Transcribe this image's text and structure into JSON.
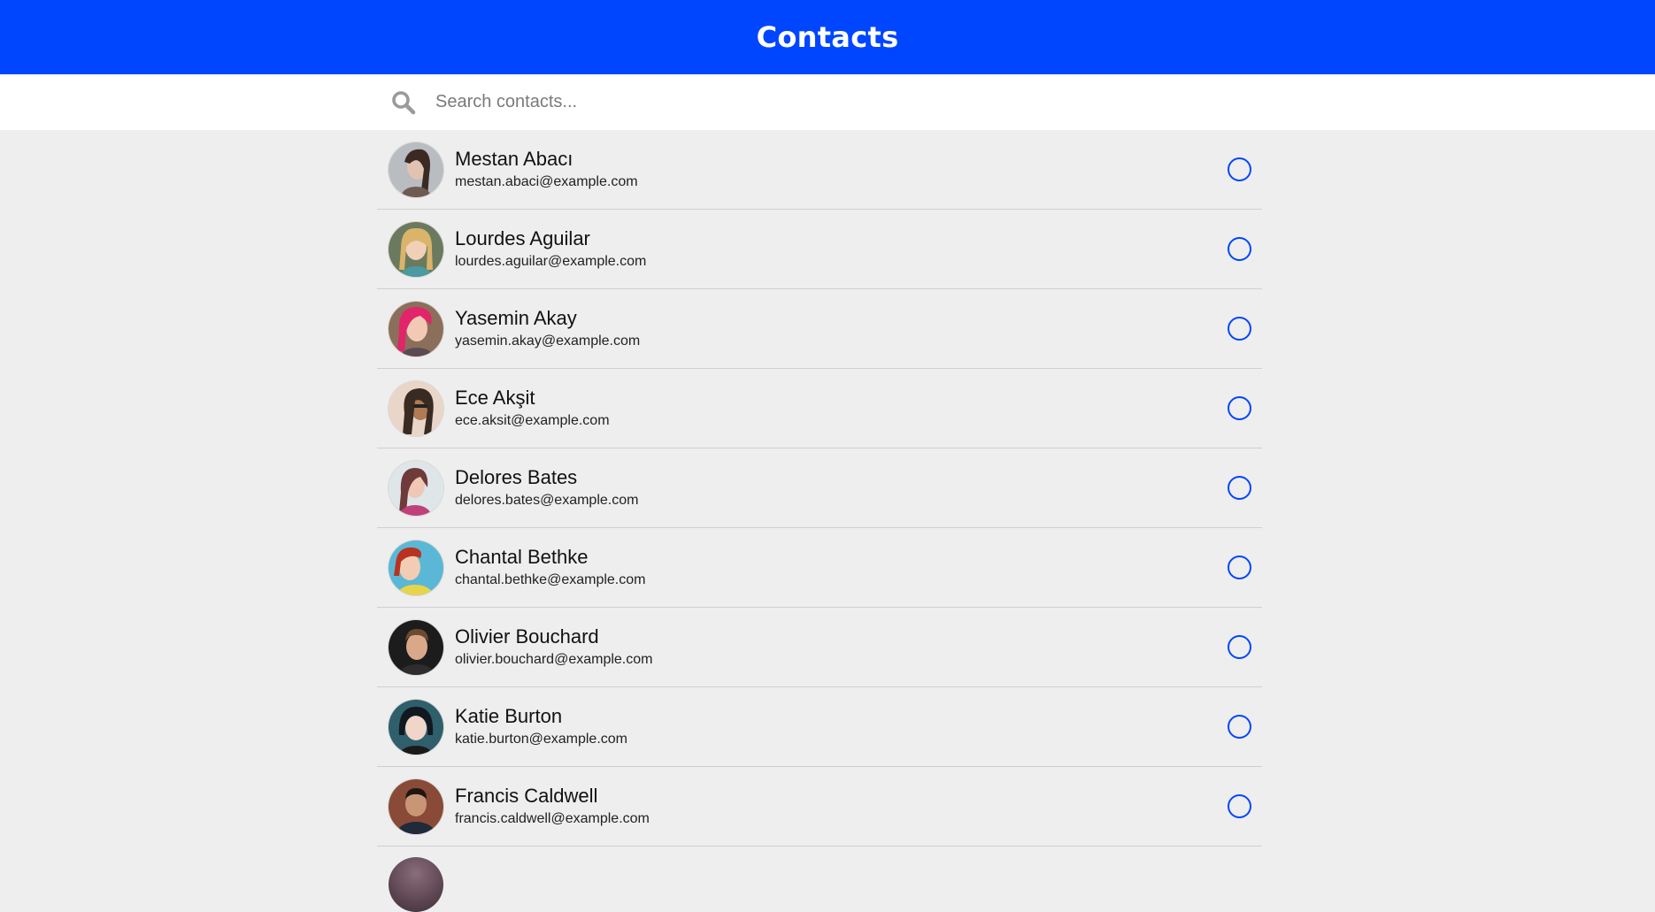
{
  "header": {
    "title": "Contacts"
  },
  "search": {
    "placeholder": "Search contacts..."
  },
  "contacts": [
    {
      "name": "Mestan Abacı",
      "email": "mestan.abaci@example.com"
    },
    {
      "name": "Lourdes Aguilar",
      "email": "lourdes.aguilar@example.com"
    },
    {
      "name": "Yasemin Akay",
      "email": "yasemin.akay@example.com"
    },
    {
      "name": "Ece Akşit",
      "email": "ece.aksit@example.com"
    },
    {
      "name": "Delores Bates",
      "email": "delores.bates@example.com"
    },
    {
      "name": "Chantal Bethke",
      "email": "chantal.bethke@example.com"
    },
    {
      "name": "Olivier Bouchard",
      "email": "olivier.bouchard@example.com"
    },
    {
      "name": "Katie Burton",
      "email": "katie.burton@example.com"
    },
    {
      "name": "Francis Caldwell",
      "email": "francis.caldwell@example.com"
    }
  ],
  "colors": {
    "accent": "#0046ff",
    "background": "#eeeeee",
    "divider": "#cfcfcf"
  }
}
